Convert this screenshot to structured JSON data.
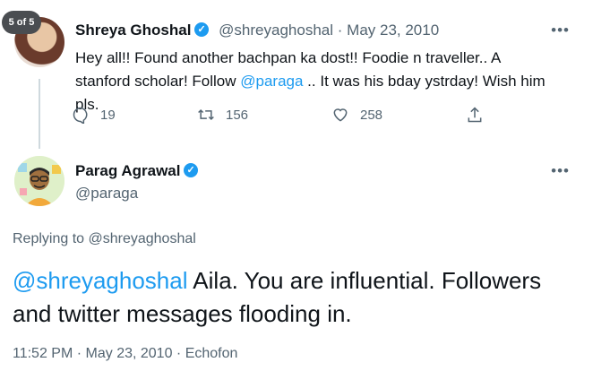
{
  "counter": "5 of 5",
  "tweet": {
    "author": "Shreya Ghoshal",
    "handle": "@shreyaghoshal",
    "sep": "·",
    "date": "May 23, 2010",
    "text_before": "Hey all!! Found another bachpan ka dost!! Foodie n traveller.. A stanford scholar! Follow ",
    "mention": "@paraga",
    "text_after": " .. It was his bday ystrday! Wish him pls.",
    "reply_count": "19",
    "retweet_count": "156",
    "like_count": "258"
  },
  "reply": {
    "author": "Parag Agrawal",
    "handle": "@paraga",
    "replying_label": "Replying to @shreyaghoshal",
    "mention": "@shreyaghoshal",
    "text": " Aila. You are influential. Followers and twitter messages flooding in.",
    "meta": "11:52 PM · May 23, 2010 · Echofon"
  },
  "icons": [
    "comment-icon",
    "retweet-icon",
    "heart-icon",
    "share-icon",
    "more-icon",
    "verified-icon"
  ],
  "colors": {
    "accent": "#1d9bf0",
    "muted": "#536471",
    "text": "#0f1419"
  }
}
